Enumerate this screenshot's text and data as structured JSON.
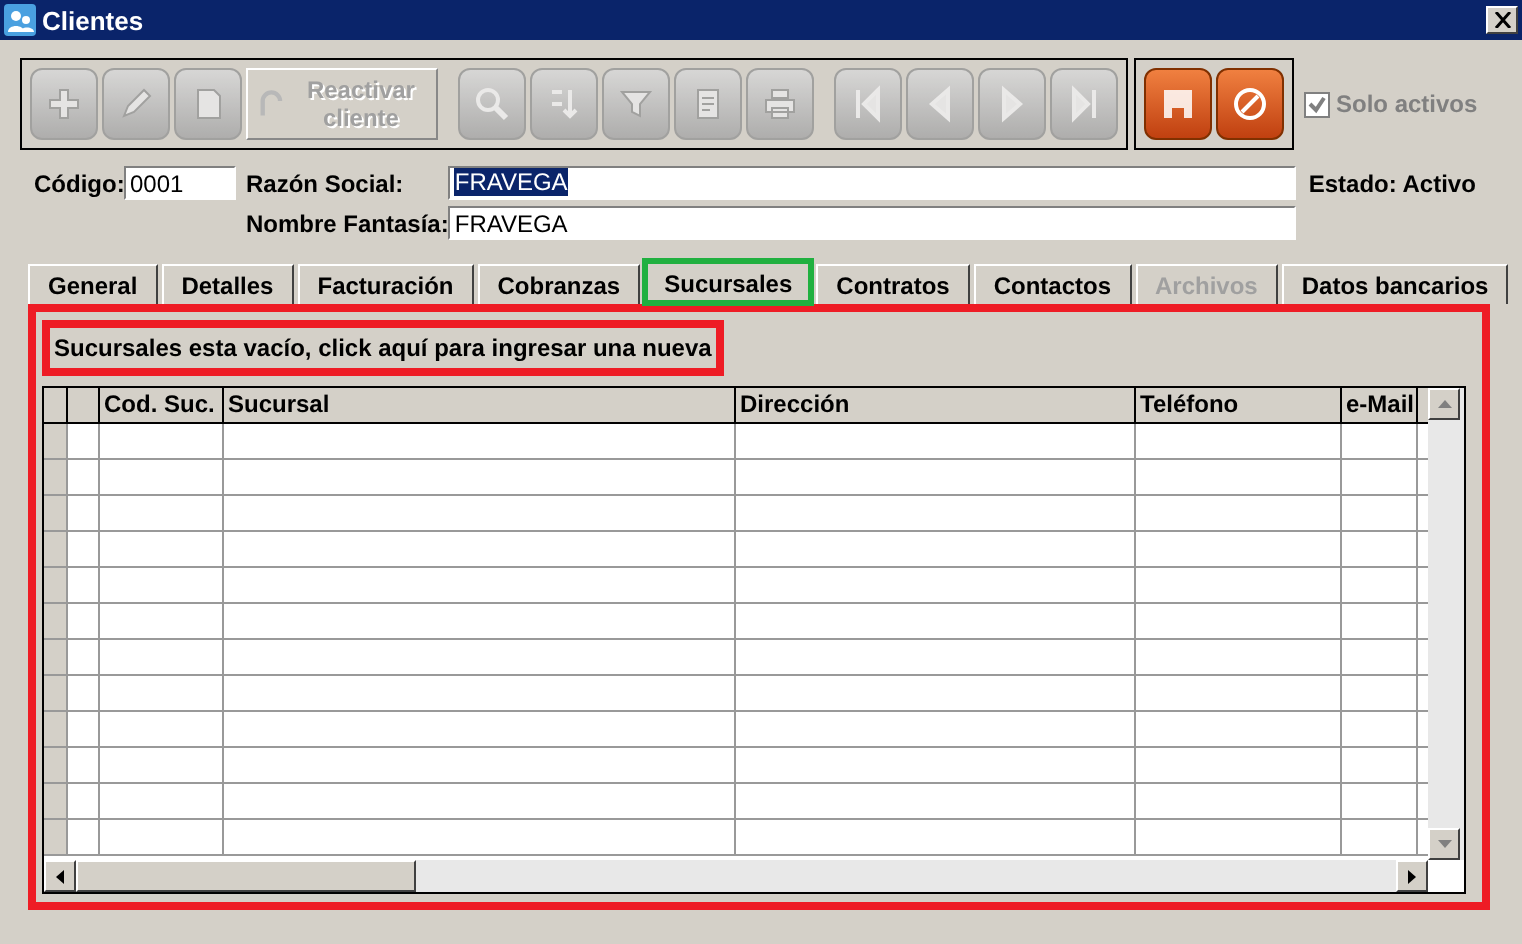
{
  "window": {
    "title": "Clientes"
  },
  "toolbar": [
    {
      "kind": "icon",
      "disabled": true
    },
    {
      "kind": "icon",
      "disabled": true
    },
    {
      "kind": "icon",
      "disabled": true
    },
    {
      "kind": "text",
      "label": "Reactivar cliente",
      "disabled": true
    },
    {
      "kind": "icon",
      "disabled": true
    },
    {
      "kind": "icon",
      "disabled": true
    },
    {
      "kind": "icon",
      "disabled": true
    },
    {
      "kind": "icon",
      "disabled": true
    },
    {
      "kind": "icon",
      "disabled": true
    },
    {
      "kind": "icon",
      "disabled": true
    },
    {
      "kind": "icon",
      "disabled": true
    },
    {
      "kind": "icon",
      "disabled": true
    },
    {
      "kind": "icon",
      "disabled": true
    }
  ],
  "actions": [
    {
      "kind": "save",
      "disabled": false
    },
    {
      "kind": "cancel",
      "disabled": false
    }
  ],
  "solo_activos": {
    "label": "Solo activos",
    "checked": true,
    "disabled": true
  },
  "form": {
    "codigo_label": "Código:",
    "codigo": "0001",
    "razon_label": "Razón Social:",
    "razon": "FRAVEGA",
    "fantasia_label": "Nombre Fantasía:",
    "fantasia": "FRAVEGA",
    "estado": "Estado: Activo"
  },
  "tabs": [
    {
      "label": "General",
      "selected": false,
      "disabled": false
    },
    {
      "label": "Detalles",
      "selected": false,
      "disabled": false
    },
    {
      "label": "Facturación",
      "selected": false,
      "disabled": false
    },
    {
      "label": "Cobranzas",
      "selected": false,
      "disabled": false
    },
    {
      "label": "Sucursales",
      "selected": true,
      "disabled": false
    },
    {
      "label": "Contratos",
      "selected": false,
      "disabled": false
    },
    {
      "label": "Contactos",
      "selected": false,
      "disabled": false
    },
    {
      "label": "Archivos",
      "selected": false,
      "disabled": true
    },
    {
      "label": "Datos bancarios",
      "selected": false,
      "disabled": false
    }
  ],
  "empty_link": "Sucursales esta vacío, click aquí para ingresar una nueva",
  "table": {
    "columns": [
      "Cod. Suc.",
      "Sucursal",
      "Dirección",
      "Teléfono",
      "e-Mail"
    ]
  }
}
